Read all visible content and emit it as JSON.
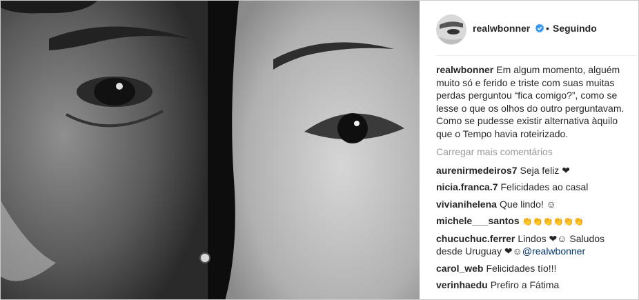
{
  "post": {
    "username": "realwbonner",
    "verified": true,
    "separator": "•",
    "follow_status": "Seguindo",
    "caption_user": "realwbonner",
    "caption_text": "Em algum momento, alguém muito só e ferido e triste com suas muitas perdas perguntou “fica comigo?”, como se lesse o que os olhos do outro perguntavam. Como se pudesse existir alternativa àquilo que o Tempo havia roteirizado.",
    "load_more": "Carregar mais comentários"
  },
  "comments": [
    {
      "user": "aurenirmedeiros7",
      "text": "Seja feliz ❤"
    },
    {
      "user": "nicia.franca.7",
      "text": "Felicidades ao casal"
    },
    {
      "user": "vivianihelena",
      "text": "Que lindo! ☺"
    },
    {
      "user": "michele___santos",
      "text": "👏👏👏👏👏👏"
    },
    {
      "user": "chucuchuc.ferrer",
      "text": "Lindos ❤☺ Saludos desde Uruguay ❤☺",
      "mention": "@realwbonner"
    },
    {
      "user": "carol_web",
      "text": "Felicidades tío!!!"
    },
    {
      "user": "verinhaedu",
      "text": "Prefiro a Fátima"
    }
  ],
  "colors": {
    "text": "#262626",
    "muted": "#999999",
    "mention": "#003569",
    "verified": "#3897f0"
  }
}
